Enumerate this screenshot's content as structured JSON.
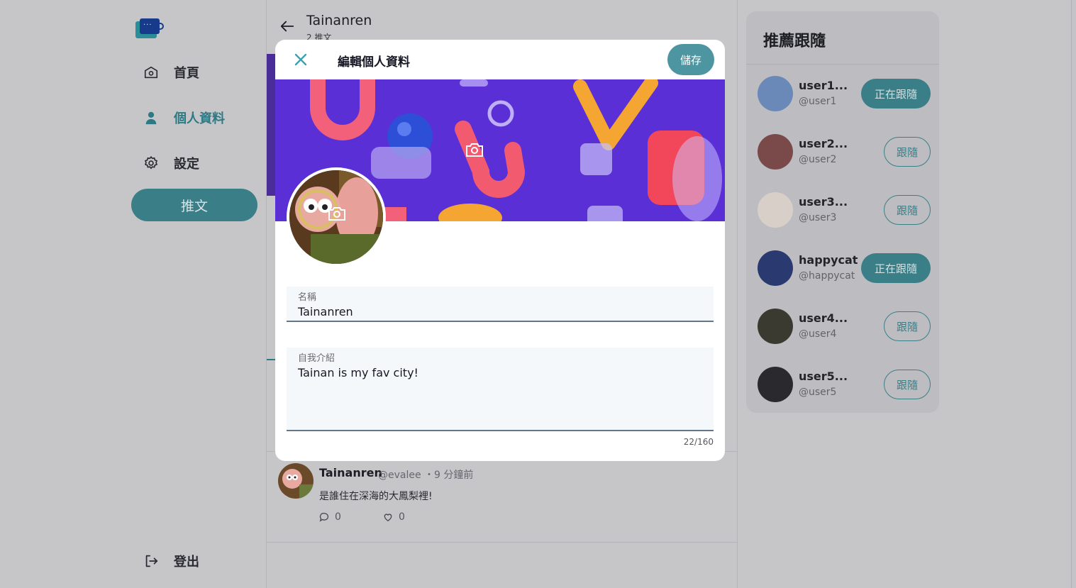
{
  "sidebar": {
    "nav": [
      {
        "label": "首頁",
        "icon": "home-icon"
      },
      {
        "label": "個人資料",
        "icon": "user-icon"
      },
      {
        "label": "設定",
        "icon": "gear-icon"
      }
    ],
    "tweet_button": "推文",
    "logout": "登出"
  },
  "main": {
    "title": "Tainanren",
    "subtitle": "2 推文",
    "tweet": {
      "name": "Tainanren",
      "meta": "@evalee ・9 分鐘前",
      "body": "是誰住在深海的大鳳梨裡!",
      "reply_count": "0",
      "like_count": "0"
    }
  },
  "modal": {
    "title": "編輯個人資料",
    "save": "儲存",
    "name_label": "名稱",
    "name_value": "Tainanren",
    "bio_label": "自我介紹",
    "bio_value": "Tainan is my fav city!",
    "counter": "22/160"
  },
  "recommend": {
    "title": "推薦跟隨",
    "users": [
      {
        "name": "user1...",
        "handle": "@user1",
        "button": "正在跟隨",
        "following": true,
        "color": "#6a88b8"
      },
      {
        "name": "user2...",
        "handle": "@user2",
        "button": "跟隨",
        "following": false,
        "color": "#7a4a4a"
      },
      {
        "name": "user3...",
        "handle": "@user3",
        "button": "跟隨",
        "following": false,
        "color": "#d8d0c8"
      },
      {
        "name": "happycat",
        "handle": "@happycat",
        "button": "正在跟隨",
        "following": true,
        "color": "#2a3a70"
      },
      {
        "name": "user4...",
        "handle": "@user4",
        "button": "跟隨",
        "following": false,
        "color": "#3a3a30"
      },
      {
        "name": "user5...",
        "handle": "@user5",
        "button": "跟隨",
        "following": false,
        "color": "#2a2a2e"
      }
    ]
  },
  "colors": {
    "accent": "#4d95a0",
    "cover": "#5b2fd6"
  }
}
